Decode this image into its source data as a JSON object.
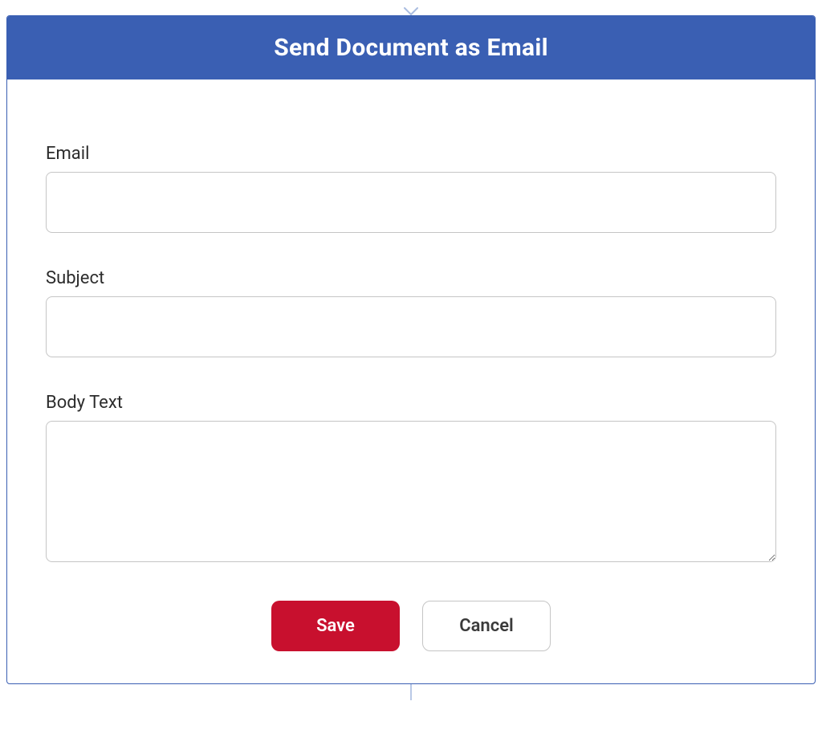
{
  "modal": {
    "title": "Send Document as Email",
    "fields": {
      "email": {
        "label": "Email",
        "value": ""
      },
      "subject": {
        "label": "Subject",
        "value": ""
      },
      "body": {
        "label": "Body Text",
        "value": ""
      }
    },
    "buttons": {
      "save": "Save",
      "cancel": "Cancel"
    }
  }
}
